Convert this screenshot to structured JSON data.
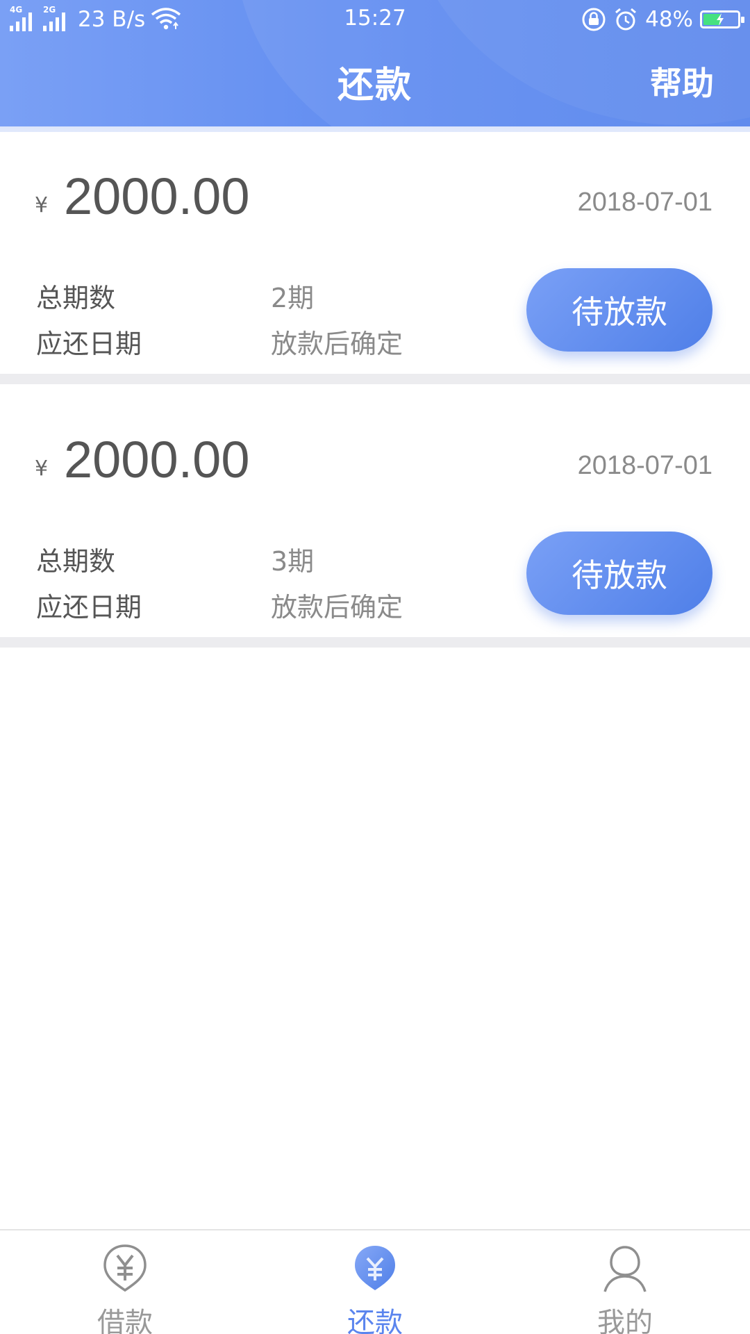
{
  "status_bar": {
    "net1": "4G",
    "net2": "2G",
    "speed": "23 B/s",
    "time": "15:27",
    "battery": "48%",
    "battery_level": 0.48,
    "battery_color": "#3de07a"
  },
  "header": {
    "title": "还款",
    "help_label": "帮助",
    "accent_color": "#5f8bf0"
  },
  "loans": [
    {
      "currency": "¥",
      "amount": "2000.00",
      "date": "2018-07-01",
      "periods_label": "总期数",
      "periods_value": "2期",
      "due_label": "应还日期",
      "due_value": "放款后确定",
      "status": "待放款"
    },
    {
      "currency": "¥",
      "amount": "2000.00",
      "date": "2018-07-01",
      "periods_label": "总期数",
      "periods_value": "3期",
      "due_label": "应还日期",
      "due_value": "放款后确定",
      "status": "待放款"
    }
  ],
  "nav": {
    "items": [
      {
        "label": "借款",
        "icon": "yen-shield-outline-icon"
      },
      {
        "label": "还款",
        "icon": "yen-shield-filled-icon",
        "active": true
      },
      {
        "label": "我的",
        "icon": "user-outline-icon"
      }
    ],
    "active_color": "#5b85ee",
    "inactive_color": "#999999"
  }
}
